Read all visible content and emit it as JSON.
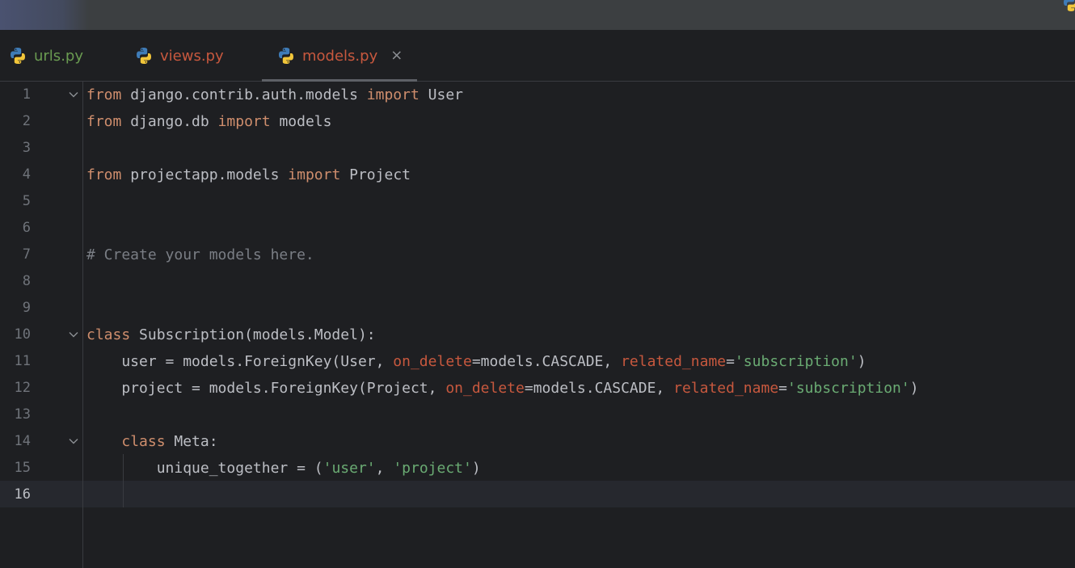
{
  "tabs": [
    {
      "label": "urls.py",
      "color": "#6a9b51",
      "active": false
    },
    {
      "label": "views.py",
      "color": "#c7583e",
      "active": false
    },
    {
      "label": "models.py",
      "color": "#c7583e",
      "active": true,
      "close": "×"
    }
  ],
  "icons": {
    "tab_icon": "python-icon",
    "fold_icon": "chevron-down-icon",
    "close_icon": "close-icon"
  },
  "editor": {
    "current_line": 16,
    "lines": [
      {
        "n": "1",
        "tokens": [
          [
            "kw",
            "from"
          ],
          [
            "p",
            " django.contrib.auth.models "
          ],
          [
            "kw",
            "import"
          ],
          [
            "p",
            " User"
          ]
        ]
      },
      {
        "n": "2",
        "tokens": [
          [
            "kw",
            "from"
          ],
          [
            "p",
            " django.db "
          ],
          [
            "kw",
            "import"
          ],
          [
            "p",
            " models"
          ]
        ]
      },
      {
        "n": "3",
        "tokens": []
      },
      {
        "n": "4",
        "tokens": [
          [
            "kw",
            "from"
          ],
          [
            "p",
            " projectapp.models "
          ],
          [
            "kw",
            "import"
          ],
          [
            "p",
            " Project"
          ]
        ]
      },
      {
        "n": "5",
        "tokens": []
      },
      {
        "n": "6",
        "tokens": []
      },
      {
        "n": "7",
        "tokens": [
          [
            "cm",
            "# Create your models here."
          ]
        ]
      },
      {
        "n": "8",
        "tokens": []
      },
      {
        "n": "9",
        "tokens": []
      },
      {
        "n": "10",
        "tokens": [
          [
            "kw",
            "class"
          ],
          [
            "p",
            " Subscription(models.Model):"
          ]
        ]
      },
      {
        "n": "11",
        "tokens": [
          [
            "p",
            "    user = models.ForeignKey(User, "
          ],
          [
            "kwarg",
            "on_delete"
          ],
          [
            "p",
            "=models.CASCADE, "
          ],
          [
            "kwarg",
            "related_name"
          ],
          [
            "p",
            "="
          ],
          [
            "str",
            "'subscription'"
          ],
          [
            "p",
            ")"
          ]
        ]
      },
      {
        "n": "12",
        "tokens": [
          [
            "p",
            "    project = models.ForeignKey(Project, "
          ],
          [
            "kwarg",
            "on_delete"
          ],
          [
            "p",
            "=models.CASCADE, "
          ],
          [
            "kwarg",
            "related_name"
          ],
          [
            "p",
            "="
          ],
          [
            "str",
            "'subscription'"
          ],
          [
            "p",
            ")"
          ]
        ]
      },
      {
        "n": "13",
        "tokens": []
      },
      {
        "n": "14",
        "tokens": [
          [
            "p",
            "    "
          ],
          [
            "kw",
            "class"
          ],
          [
            "p",
            " Meta:"
          ]
        ]
      },
      {
        "n": "15",
        "tokens": [
          [
            "p",
            "        unique_together = ("
          ],
          [
            "str",
            "'user'"
          ],
          [
            "p",
            ", "
          ],
          [
            "str",
            "'project'"
          ],
          [
            "p",
            ")"
          ]
        ]
      },
      {
        "n": "16",
        "tokens": []
      }
    ],
    "fold_lines": [
      "1",
      "10",
      "14"
    ]
  }
}
